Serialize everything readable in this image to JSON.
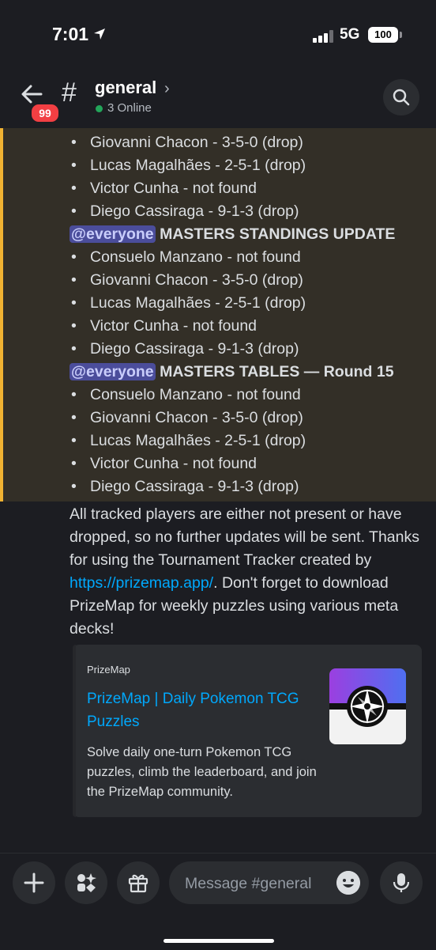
{
  "status": {
    "time": "7:01",
    "network": "5G",
    "battery": "100"
  },
  "header": {
    "unread_badge": "99",
    "channel_hash": "#",
    "channel_name": "general",
    "chevron": "›",
    "online_text": "3 Online"
  },
  "message": {
    "first_list": [
      "Giovanni Chacon - 3-5-0 (drop)",
      "Lucas Magalhães - 2-5-1 (drop)",
      "Victor Cunha - not found",
      "Diego Cassiraga - 9-1-3 (drop)"
    ],
    "section1": {
      "mention": "@everyone",
      "title": "MASTERS STANDINGS UPDATE",
      "items": [
        "Consuelo Manzano - not found",
        "Giovanni Chacon - 3-5-0 (drop)",
        "Lucas Magalhães - 2-5-1 (drop)",
        "Victor Cunha - not found",
        "Diego Cassiraga - 9-1-3 (drop)"
      ]
    },
    "section2": {
      "mention": "@everyone",
      "title": "MASTERS TABLES — Round 15",
      "items": [
        "Consuelo Manzano - not found",
        "Giovanni Chacon - 3-5-0 (drop)",
        "Lucas Magalhães - 2-5-1 (drop)",
        "Victor Cunha - not found",
        "Diego Cassiraga - 9-1-3 (drop)"
      ]
    },
    "bullet": "•",
    "closing_text_before_link": "All tracked players are either not present or have dropped, so no further updates will be sent. Thanks for using the Tournament Tracker created by ",
    "closing_link": "https://prizemap.app/",
    "closing_text_after_link": ". Don't forget to download PrizeMap for weekly puzzles using various meta decks!"
  },
  "embed": {
    "provider": "PrizeMap",
    "title": "PrizeMap | Daily Pokemon TCG Puzzles",
    "description": "Solve daily one-turn Pokemon TCG puzzles, climb the leaderboard, and join the PrizeMap community."
  },
  "composer": {
    "placeholder": "Message #general"
  },
  "colors": {
    "background": "#1c1d22",
    "highlight": "#332f27",
    "highlight_bar": "#f0b232",
    "link": "#00a8fc",
    "mention_bg": "#4b4d9b",
    "online": "#23a55a",
    "badge": "#f23f43"
  },
  "icons": [
    "location-arrow-icon",
    "signal-icon",
    "back-arrow-icon",
    "hash-icon",
    "chevron-right-icon",
    "search-icon",
    "plus-icon",
    "apps-icon",
    "gift-icon",
    "emoji-icon",
    "microphone-icon",
    "compass-icon"
  ]
}
